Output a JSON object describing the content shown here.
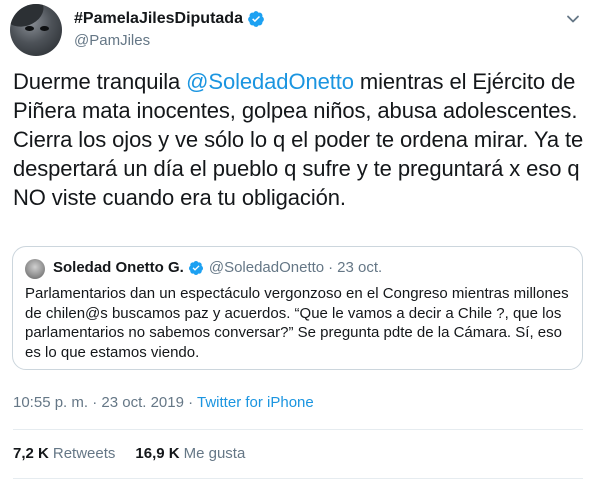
{
  "author": {
    "display_name": "#PamelaJilesDiputada",
    "handle": "@PamJiles",
    "verified": true
  },
  "tweet": {
    "text_before": "Duerme tranquila ",
    "mention": "@SoledadOnetto",
    "text_after": " mientras el Ejército de Piñera mata inocentes, golpea niños, abusa adolescentes. Cierra los ojos y ve sólo lo q el poder te ordena mirar. Ya te despertará un día el pueblo q sufre y te preguntará x eso q NO viste cuando era tu obligación."
  },
  "quoted_tweet": {
    "display_name": "Soledad Onetto G.",
    "handle": "@SoledadOnetto",
    "separator": "·",
    "date": "23 oct.",
    "text": "Parlamentarios dan un espectáculo vergonzoso en el Congreso mientras millones de chilen@s buscamos paz y acuerdos. “Que le vamos a decir a Chile ?, que los parlamentarios no sabemos conversar?” Se pregunta pdte de la Cámara. Sí, eso es lo que estamos viendo."
  },
  "meta": {
    "timestamp": "10:55 p. m. · 23 oct. 2019",
    "separator": " · ",
    "source": "Twitter for iPhone"
  },
  "stats": {
    "retweets_count": "7,2 K",
    "retweets_label": "Retweets",
    "likes_count": "16,9 K",
    "likes_label": "Me gusta"
  },
  "colors": {
    "link": "#1b95e0",
    "verified": "#1da1f2",
    "secondary_text": "#657786",
    "border": "#ccd6dd"
  },
  "icons": {
    "verified": "verified-badge-icon",
    "more": "chevron-down-icon"
  }
}
